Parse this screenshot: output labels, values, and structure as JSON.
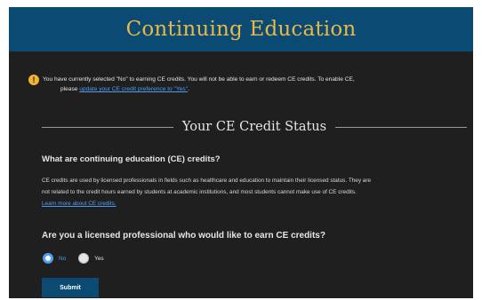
{
  "header": {
    "title": "Continuing Education"
  },
  "notice": {
    "icon": "warning-icon",
    "line1": "You have currently selected \"No\" to earning CE credits. You will not be able to earn or redeem CE credits. To enable CE,",
    "line2_prefix": "please ",
    "line2_link": "update your CE credit preference to \"Yes\"",
    "line2_suffix": "."
  },
  "section": {
    "title": "Your CE Credit Status"
  },
  "question1": {
    "title": "What are continuing education (CE) credits?",
    "para_line1": "CE credits are used by licensed professionals in fields such as healthcare and education to maintain their licensed status. They are",
    "para_line2": "not related to the credit hours earned by students at academic institutions, and most students cannot make use of CE credits.",
    "learn_more": "Learn more about CE credits."
  },
  "question2": {
    "title": "Are you a licensed professional who would like to earn CE credits?",
    "options": [
      {
        "label": "No",
        "selected": true
      },
      {
        "label": "Yes",
        "selected": false
      }
    ]
  },
  "submit": {
    "label": "Submit"
  },
  "colors": {
    "header_bg": "#0b4a72",
    "title_gold": "#e8b84a",
    "page_bg": "#1f1f1f",
    "link": "#4f9ff0",
    "warning": "#f2b233"
  }
}
